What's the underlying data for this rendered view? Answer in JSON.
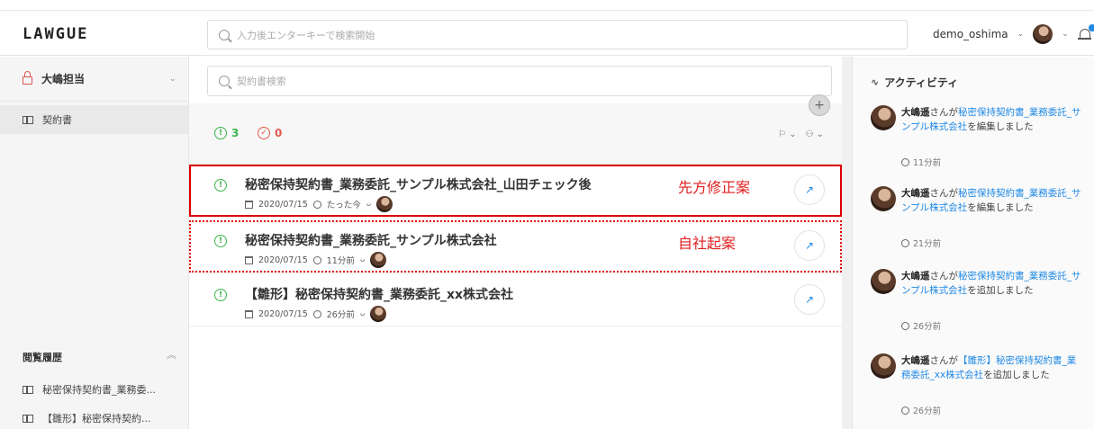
{
  "app": {
    "logo": "LAWGUE"
  },
  "header": {
    "search_placeholder": "入力後エンターキーで検索開始",
    "username": "demo_oshima",
    "user_chevron": "⌄"
  },
  "sidebar": {
    "team": "大嶋担当",
    "team_chevron": "⌄",
    "nav_items": [
      {
        "label": "契約書"
      }
    ],
    "history_title": "閲覧履歴",
    "history_chevron": "︽",
    "history_items": [
      {
        "label": "秘密保持契約書_業務委..."
      },
      {
        "label": "【雛形】秘密保持契約..."
      }
    ]
  },
  "main": {
    "search_placeholder": "契約書検索",
    "add_label": "+",
    "pending_count": "3",
    "done_count": "0",
    "status_icon_glyph": "!",
    "done_icon_glyph": "✓",
    "open_icon_glyph": "↗",
    "person_glyph": "ᴗ",
    "filter_flag": "⚐ ⌄",
    "filter_people": "⚇ ⌄",
    "contracts": [
      {
        "title": "秘密保持契約書_業務委託_サンプル株式会社_山田チェック後",
        "date": "2020/07/15",
        "time": "たった今",
        "annotation": "先方修正案"
      },
      {
        "title": "秘密保持契約書_業務委託_サンプル株式会社",
        "date": "2020/07/15",
        "time": "11分前",
        "annotation": "自社起案"
      },
      {
        "title": "【雛形】秘密保持契約書_業務委託_xx株式会社",
        "date": "2020/07/15",
        "time": "26分前",
        "annotation": ""
      }
    ]
  },
  "activity": {
    "title": "アクティビティ",
    "pulse_glyph": "∿",
    "items": [
      {
        "user": "大嶋遥",
        "pre": "さんが",
        "doc": "秘密保持契約書_業務委託_サンプル株式会社",
        "post": "を編集しました",
        "time": "11分前"
      },
      {
        "user": "大嶋遥",
        "pre": "さんが",
        "doc": "秘密保持契約書_業務委託_サンプル株式会社",
        "post": "を編集しました",
        "time": "21分前"
      },
      {
        "user": "大嶋遥",
        "pre": "さんが",
        "doc": "秘密保持契約書_業務委託_サンプル株式会社",
        "post": "を追加しました",
        "time": "26分前"
      },
      {
        "user": "大嶋遥",
        "pre": "さんが",
        "doc": "【雛形】秘密保持契約書_業務委託_xx株式会社",
        "post": "を追加しました",
        "time": "26分前"
      }
    ]
  },
  "colors": {
    "accent": "#1e88e5",
    "success": "#3cb54a",
    "danger": "#e05a4f",
    "annotation": "#e02020"
  }
}
